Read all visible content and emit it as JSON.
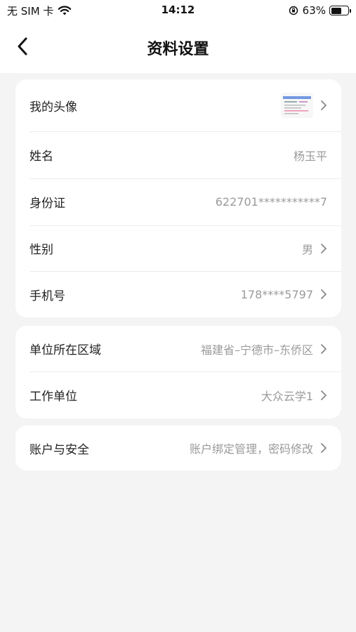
{
  "status_bar": {
    "carrier": "无 SIM 卡",
    "time": "14:12",
    "battery_percent": "63%",
    "battery_level": 0.63
  },
  "nav": {
    "title": "资料设置"
  },
  "card1": [
    {
      "label": "我的头像",
      "value": ""
    },
    {
      "label": "姓名",
      "value": "杨玉平"
    },
    {
      "label": "身份证",
      "value": "622701***********7"
    },
    {
      "label": "性别",
      "value": "男"
    },
    {
      "label": "手机号",
      "value": "178****5797"
    }
  ],
  "card2": [
    {
      "label": "单位所在区域",
      "value": "福建省–宁德市–东侨区"
    },
    {
      "label": "工作单位",
      "value": "大众云学1"
    }
  ],
  "card3": [
    {
      "label": "账户与安全",
      "value": "账户绑定管理，密码修改"
    }
  ],
  "colors": {
    "background": "#f4f4f4",
    "card": "#ffffff",
    "label": "#222222",
    "value": "#9a9a9a"
  },
  "icons": [
    "wifi-icon",
    "rotation-lock-icon",
    "battery-icon",
    "back-arrow-icon",
    "chevron-right-icon"
  ]
}
